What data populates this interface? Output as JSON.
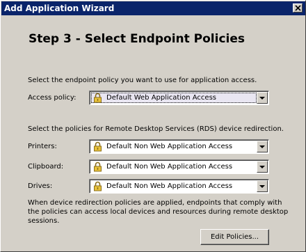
{
  "window": {
    "title": "Add Application Wizard"
  },
  "step": {
    "heading": "Step 3 - Select Endpoint Policies"
  },
  "endpoint_section": {
    "instruction": "Select the endpoint policy you want to use for application access.",
    "access_policy": {
      "label": "Access policy:",
      "value": "Default Web Application Access"
    }
  },
  "rds_section": {
    "instruction": "Select the policies for Remote Desktop Services (RDS) device redirection.",
    "fields": [
      {
        "label": "Printers:",
        "value": "Default Non Web Application Access"
      },
      {
        "label": "Clipboard:",
        "value": "Default Non Web Application Access"
      },
      {
        "label": "Drives:",
        "value": "Default Non Web Application Access"
      }
    ],
    "note_lines": [
      "When device redirection policies are applied, endpoints that comply with",
      "the policies can access local devices and resources during remote desktop",
      "sessions."
    ]
  },
  "buttons": {
    "edit_policies": "Edit Policies..."
  },
  "icons": {
    "close": "close-icon",
    "dropdown": "chevron-down-icon",
    "policy": "lock-icon"
  }
}
